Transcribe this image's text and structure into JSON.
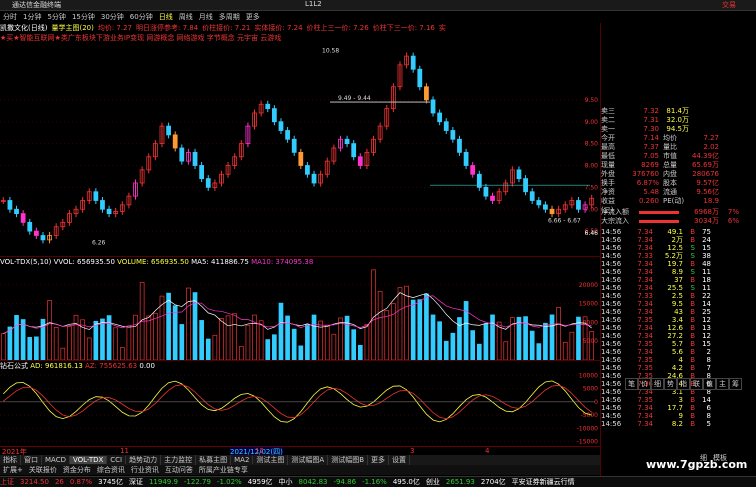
{
  "titlebar": {
    "app_name": "通达信金融终端",
    "version": "L1L2",
    "brand": "交易"
  },
  "toolbar": {
    "items": [
      "分时",
      "1分钟",
      "5分钟",
      "15分钟",
      "30分钟",
      "60分钟",
      "日线",
      "周线",
      "月线",
      "多周期",
      "更多"
    ],
    "selected_index": 6
  },
  "header": {
    "items": [
      "凯撒文化(日线)",
      "量学主图(20)",
      "均价: 7.27",
      "明日涨停参考: 7.84",
      "价柱接价: 7.21",
      "实体接价: 7.24",
      "价柱上三一价: 7.26",
      "价柱下三一价: 7.16",
      "实"
    ],
    "line2": "★买★智能互联网★类广东板块下游业务IP变现 网游概念 网络游戏 字节概念 元宇宙 云游戏"
  },
  "price_labels": {
    "high": "10.58",
    "mid": "9.49 - 9.44",
    "low1": "6.26",
    "low2": "6.66 - 6.67",
    "current": "6.46"
  },
  "y_axis": [
    "9.50",
    "9.00",
    "8.50",
    "8.00",
    "7.50",
    "7.00",
    "6.50"
  ],
  "vol_header": {
    "name": "VOL-TDX(5,10)",
    "vvol": "VVOL: 656935.50",
    "volume": "VOLUME: 656935.50",
    "ma5": "MA5: 411886.75",
    "ma10": "MA10: 374095.38"
  },
  "vol_y_axis": [
    "20000",
    "15000",
    "10000",
    "5000"
  ],
  "ind_header": {
    "name": "钻石公式",
    "ad": "AD: 961816.13",
    "az": "AZ: 755625.63",
    "z": "0.00"
  },
  "ind_y_axis": [
    "10000",
    "5000",
    "0",
    "-5000",
    "-10000",
    "-15000"
  ],
  "time_axis": [
    "2021年",
    "11",
    "2021/12/02(四)",
    "12",
    "3",
    "4"
  ],
  "tabs": [
    "指标",
    "窗口",
    "MACD",
    "VOL-TDX",
    "CCI",
    "趋势动力",
    "主力监控",
    "私募主图",
    "MA2",
    "测试主图",
    "测试幅图A",
    "测试幅图B",
    "更多",
    "设置"
  ],
  "tabs2": [
    "扩展+",
    "关联报价",
    "资金分布",
    "综合资讯",
    "行业资讯",
    "互动问答",
    "所属产业链专享"
  ],
  "status": {
    "sh_label": "上证",
    "sh": "3214.50",
    "sh_chg": "26",
    "sh_pct": "0.87%",
    "sh_amt": "3745亿",
    "sz_label": "深证",
    "sz": "11949.9",
    "sz_chg": "-122.79",
    "sz_pct": "-1.02%",
    "sz_amt": "4959亿",
    "zx_label": "中小",
    "zx": "8042.83",
    "zx_chg": "-94.86",
    "zx_pct": "-1.16%",
    "zx_amt": "495.0亿",
    "cy_label": "创业",
    "cy": "2651.93",
    "cy_amt": "2704亿",
    "broker": "平安证券新疆云行情"
  },
  "side": {
    "quotes": [
      {
        "l": "卖三",
        "v": "7.32",
        "n": "81.4万"
      },
      {
        "l": "卖二",
        "v": "7.31",
        "n": "32.0万"
      },
      {
        "l": "卖一",
        "v": "7.30",
        "n": "94.5万"
      },
      {
        "l": "今开",
        "v": "7.14",
        "n": "均价",
        "n2": "7.27"
      },
      {
        "l": "最高",
        "v": "7.37",
        "n": "量比",
        "n2": "2.02"
      },
      {
        "l": "最低",
        "v": "7.05",
        "n": "市值",
        "n2": "44.39亿"
      },
      {
        "l": "现量",
        "v": "8269",
        "n": "总量",
        "n2": "65.69万"
      },
      {
        "l": "外盘",
        "v": "376760",
        "n": "内盘",
        "n2": "280676"
      },
      {
        "l": "换手",
        "v": "6.87%",
        "n": "股本",
        "n2": "9.57亿"
      },
      {
        "l": "净资",
        "v": "5.48",
        "n": "流通",
        "n2": "9.56亿"
      },
      {
        "l": "收益(三)",
        "v": "0.260",
        "n": "PE(动)",
        "n2": "18.9"
      }
    ],
    "flow": [
      {
        "l": "净流入额",
        "v": "6968万",
        "p": "7%"
      },
      {
        "l": "大宗流入",
        "v": "3034万",
        "p": "6%"
      }
    ],
    "ticks": [
      {
        "t": "14:56",
        "p": "7.34",
        "q": "49.1",
        "d": "B",
        "n": "75"
      },
      {
        "t": "14:56",
        "p": "7.34",
        "q": "2万",
        "d": "B",
        "n": "24"
      },
      {
        "t": "14:56",
        "p": "7.34",
        "q": "12.5",
        "d": "S",
        "n": "15"
      },
      {
        "t": "14:56",
        "p": "7.33",
        "q": "5.2万",
        "d": "S",
        "n": "38"
      },
      {
        "t": "14:56",
        "p": "7.34",
        "q": "19.7",
        "d": "B",
        "n": "48"
      },
      {
        "t": "14:56",
        "p": "7.34",
        "q": "8.9",
        "d": "S",
        "n": "11"
      },
      {
        "t": "14:56",
        "p": "7.34",
        "q": "37",
        "d": "B",
        "n": "18"
      },
      {
        "t": "14:56",
        "p": "7.34",
        "q": "25.5",
        "d": "S",
        "n": "11"
      },
      {
        "t": "14:56",
        "p": "7.33",
        "q": "2.5",
        "d": "B",
        "n": "22"
      },
      {
        "t": "14:56",
        "p": "7.34",
        "q": "9.5",
        "d": "B",
        "n": "14"
      },
      {
        "t": "14:56",
        "p": "7.34",
        "q": "43",
        "d": "B",
        "n": "25"
      },
      {
        "t": "14:56",
        "p": "7.35",
        "q": "3.4",
        "d": "B",
        "n": "12"
      },
      {
        "t": "14:56",
        "p": "7.34",
        "q": "12.6",
        "d": "B",
        "n": "13"
      },
      {
        "t": "14:56",
        "p": "7.34",
        "q": "27.2",
        "d": "B",
        "n": "12"
      },
      {
        "t": "14:56",
        "p": "7.35",
        "q": "5.7",
        "d": "B",
        "n": "15"
      },
      {
        "t": "14:56",
        "p": "7.34",
        "q": "5.6",
        "d": "B",
        "n": "2"
      },
      {
        "t": "14:56",
        "p": "7.35",
        "q": "4",
        "d": "B",
        "n": "8"
      },
      {
        "t": "14:56",
        "p": "7.35",
        "q": "4.2",
        "d": "B",
        "n": "7"
      },
      {
        "t": "14:56",
        "p": "7.35",
        "q": "24.6",
        "d": "B",
        "n": "8"
      },
      {
        "t": "14:56",
        "p": "7.36",
        "q": "4",
        "d": "B",
        "n": "6"
      },
      {
        "t": "14:56",
        "p": "7.34",
        "q": "3.1",
        "d": "B",
        "n": "8"
      },
      {
        "t": "14:56",
        "p": "7.35",
        "q": "3",
        "d": "B",
        "n": "14"
      },
      {
        "t": "14:56",
        "p": "7.34",
        "q": "17.7",
        "d": "B",
        "n": "6"
      },
      {
        "t": "14:56",
        "p": "7.34",
        "q": "9",
        "d": "B",
        "n": "8"
      },
      {
        "t": "14:56",
        "p": "7.34",
        "q": "8.2",
        "d": "B",
        "n": "5"
      }
    ],
    "bottom_tabs": [
      "笔",
      "价",
      "细",
      "势",
      "指",
      "联",
      "值",
      "主",
      "筹"
    ],
    "footer_tabs": [
      "细",
      "模板"
    ]
  },
  "watermark": "www.7gpzb.com",
  "colors": {
    "up": "#e33",
    "down": "#3cf",
    "magenta": "#f3c",
    "ma5": "#fff",
    "ma10": "#ff4"
  }
}
